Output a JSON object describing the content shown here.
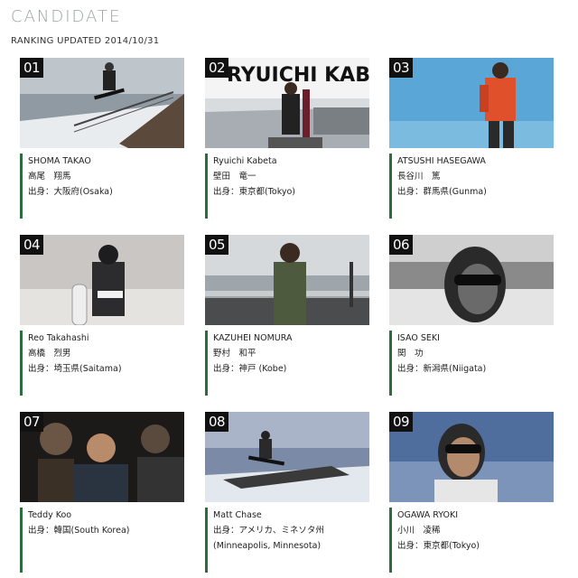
{
  "page": {
    "title": "CANDIDATE",
    "updated": "RANKING UPDATED 2014/10/31"
  },
  "candidates": [
    {
      "num": "01",
      "name": "SHOMA TAKAO",
      "jp": "高尾　翔馬",
      "origin": "出身：大阪府(Osaka)",
      "origin2": ""
    },
    {
      "num": "02",
      "name": "Ryuichi Kabeta",
      "jp": "壁田　竜一",
      "origin": "出身：東京都(Tokyo)",
      "origin2": "",
      "overlay": "RYUICHI KABETA"
    },
    {
      "num": "03",
      "name": "ATSUSHI HASEGAWA",
      "jp": "長谷川　篤",
      "origin": "出身：群馬県(Gunma)",
      "origin2": ""
    },
    {
      "num": "04",
      "name": "Reo Takahashi",
      "jp": "高橋　烈男",
      "origin": "出身：埼玉県(Saitama)",
      "origin2": ""
    },
    {
      "num": "05",
      "name": "KAZUHEI NOMURA",
      "jp": "野村　和平",
      "origin": "出身：神戸 (Kobe)",
      "origin2": ""
    },
    {
      "num": "06",
      "name": "ISAO SEKI",
      "jp": "関　功",
      "origin": "出身：新潟県(Niigata)",
      "origin2": ""
    },
    {
      "num": "07",
      "name": "Teddy Koo",
      "jp": "出身：韓国(South Korea)",
      "origin": "",
      "origin2": ""
    },
    {
      "num": "08",
      "name": "Matt Chase",
      "jp": "出身：アメリカ、ミネソタ州",
      "origin": "(Minneapolis, Minnesota)",
      "origin2": ""
    },
    {
      "num": "09",
      "name": "OGAWA RYOKI",
      "jp": "小川　凌稀",
      "origin": "出身：東京都(Tokyo)",
      "origin2": ""
    }
  ],
  "colors": {
    "accent": "#2e6b3f",
    "badge": "#111111",
    "title": "#9aa39e"
  }
}
